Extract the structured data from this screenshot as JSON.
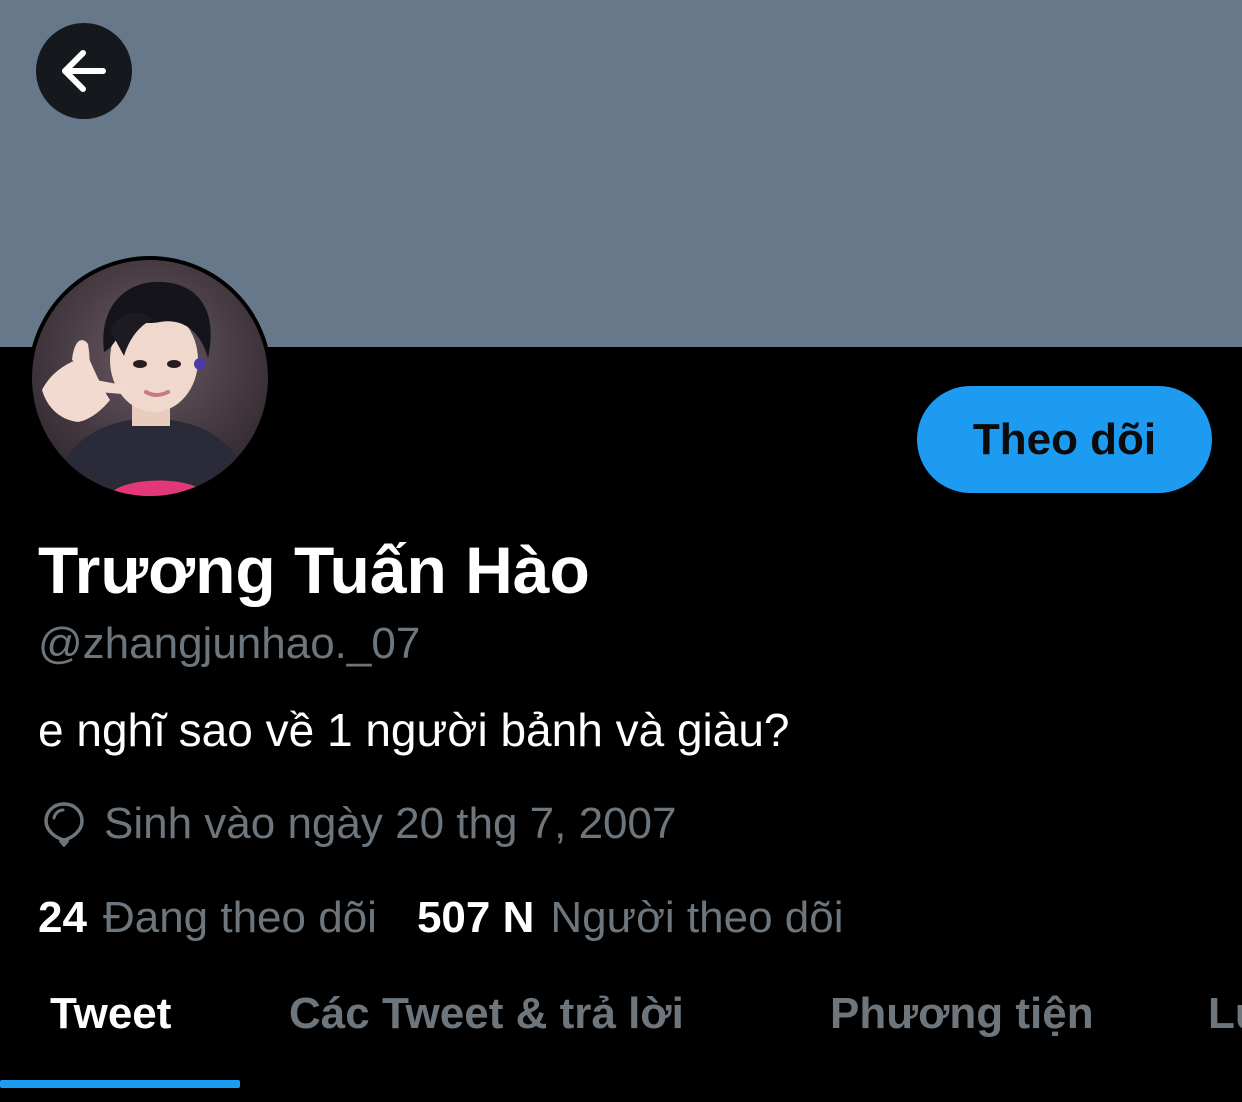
{
  "colors": {
    "banner": "#66788a",
    "accent": "#1d9bf0",
    "secondary_text": "#6e767d",
    "background": "#000000"
  },
  "header": {
    "back_icon": "arrow-left-icon"
  },
  "profile": {
    "follow_label": "Theo dõi",
    "display_name": "Trương Tuấn Hào",
    "handle": "@zhangjunhao._07",
    "bio": "e nghĩ sao về 1 người bảnh và giàu?",
    "birth_icon": "balloon-icon",
    "birth_text": "Sinh vào ngày 20 thg 7, 2007"
  },
  "stats": {
    "following_count": "24",
    "following_label": "Đang theo dõi",
    "followers_count": "507 N",
    "followers_label": "Người theo dõi"
  },
  "tabs": [
    {
      "label": "Tweet",
      "active": true
    },
    {
      "label": "Các Tweet & trả lời",
      "active": false
    },
    {
      "label": "Phương tiện",
      "active": false
    },
    {
      "label": "Lư",
      "active": false
    }
  ]
}
